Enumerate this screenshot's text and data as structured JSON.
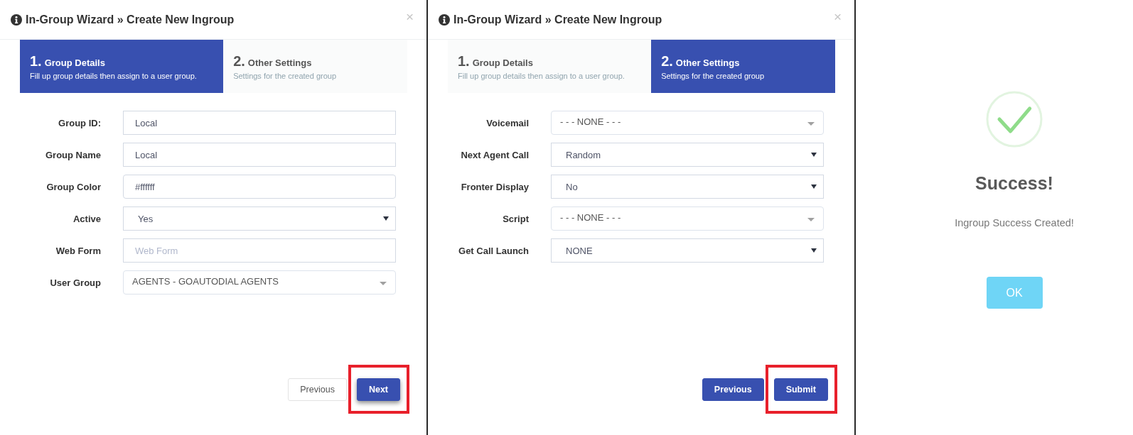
{
  "panels": [
    {
      "kind": "wizard",
      "title": "In-Group Wizard » Create New Ingroup",
      "close": "×",
      "steps": [
        {
          "number": "1.",
          "title": "Group Details",
          "description": "Fill up group details then assign to a user group.",
          "selected": true
        },
        {
          "number": "2.",
          "title": "Other Settings",
          "description": "Settings for the created group",
          "selected": false
        }
      ],
      "fields": [
        {
          "label": "Group ID:",
          "kind": "text",
          "value": "Local"
        },
        {
          "label": "Group Name",
          "kind": "text",
          "value": "Local"
        },
        {
          "label": "Group Color",
          "kind": "color",
          "value": "#ffffff"
        },
        {
          "label": "Active",
          "kind": "select",
          "value": "Yes"
        },
        {
          "label": "Web Form",
          "kind": "text",
          "placeholder": "Web Form"
        },
        {
          "label": "User Group",
          "kind": "combo",
          "value": "AGENTS - GOAUTODIAL AGENTS"
        }
      ],
      "buttons": [
        {
          "label": "Previous",
          "kind": "default",
          "focused": false,
          "highlighted": false
        },
        {
          "label": "Next",
          "kind": "primary",
          "focused": true,
          "highlighted": true
        }
      ]
    },
    {
      "kind": "wizard",
      "title": "In-Group Wizard » Create New Ingroup",
      "close": "×",
      "steps": [
        {
          "number": "1.",
          "title": "Group Details",
          "description": "Fill up group details then assign to a user group.",
          "selected": false
        },
        {
          "number": "2.",
          "title": "Other Settings",
          "description": "Settings for the created group",
          "selected": true
        }
      ],
      "fields": [
        {
          "label": "Voicemail",
          "kind": "combo",
          "value": "- - - NONE - - -"
        },
        {
          "label": "Next Agent Call",
          "kind": "select",
          "value": "Random"
        },
        {
          "label": "Fronter Display",
          "kind": "select",
          "value": "No"
        },
        {
          "label": "Script",
          "kind": "combo",
          "value": "- - - NONE - - -"
        },
        {
          "label": "Get Call Launch",
          "kind": "select",
          "value": "NONE"
        }
      ],
      "buttons": [
        {
          "label": "Previous",
          "kind": "primary",
          "focused": false,
          "highlighted": false
        },
        {
          "label": "Submit",
          "kind": "primary",
          "focused": false,
          "highlighted": true
        }
      ]
    },
    {
      "kind": "alert",
      "title": "Success!",
      "message": "Ingroup Success Created!",
      "button": {
        "label": "OK"
      }
    }
  ]
}
